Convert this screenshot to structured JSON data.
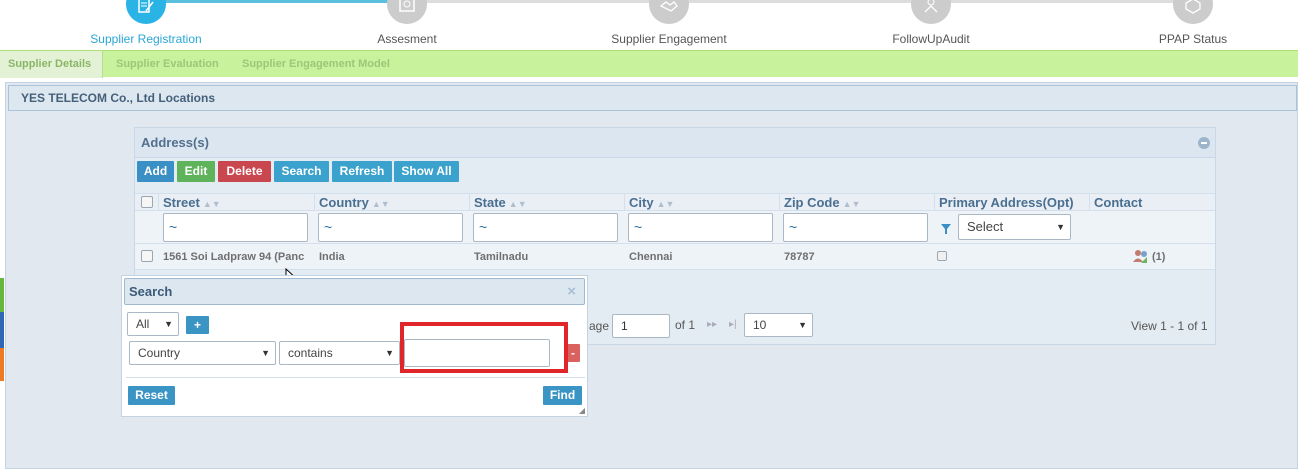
{
  "stepper": {
    "steps": [
      {
        "label": "Supplier Registration",
        "icon": "registration-icon"
      },
      {
        "label": "Assesment",
        "icon": "assessment-icon"
      },
      {
        "label": "Supplier Engagement",
        "icon": "handshake-icon"
      },
      {
        "label": "FollowUpAudit",
        "icon": "audit-icon"
      },
      {
        "label": "PPAP Status",
        "icon": "ppap-icon"
      }
    ]
  },
  "tabs": [
    "Supplier Details",
    "Supplier Evaluation",
    "Supplier Engagement Model"
  ],
  "section_title": "YES TELECOM Co., Ltd Locations",
  "grid": {
    "caption": "Address(s)",
    "buttons": {
      "add": "Add",
      "edit": "Edit",
      "delete": "Delete",
      "search": "Search",
      "refresh": "Refresh",
      "show_all": "Show All"
    },
    "columns": [
      "Street",
      "Country",
      "State",
      "City",
      "Zip Code",
      "Primary Address(Opt)",
      "Contact"
    ],
    "filter_placeholder": "~",
    "filter_select": "Select",
    "rows": [
      {
        "street": "1561 Soi Ladpraw 94 (Panc",
        "country": "India",
        "state": "Tamilnadu",
        "city": "Chennai",
        "zip": "78787",
        "contact": "(1)"
      }
    ],
    "pager": {
      "page_label": "age",
      "page_value": "1",
      "of_label": "of 1",
      "page_size": "10",
      "view_text": "View 1 - 1 of 1"
    }
  },
  "search_dialog": {
    "title": "Search",
    "group_op": "All",
    "add_label": "+",
    "field": "Country",
    "operator": "contains",
    "value": "",
    "remove_label": "-",
    "reset_label": "Reset",
    "find_label": "Find"
  },
  "colors": {
    "accent": "#2ab4e6",
    "tabbar": "#c9f29c",
    "highlight": "#e0262b"
  }
}
